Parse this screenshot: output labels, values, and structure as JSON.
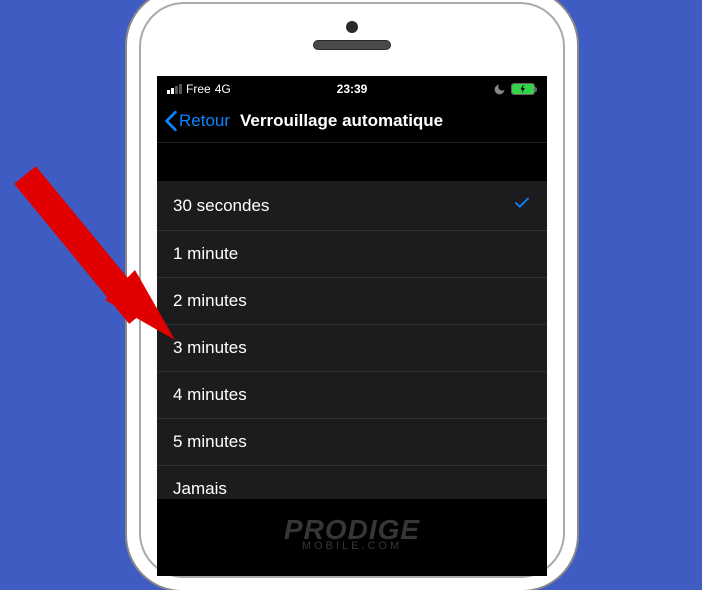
{
  "status": {
    "carrier": "Free",
    "network": "4G",
    "time": "23:39"
  },
  "nav": {
    "back_label": "Retour",
    "title": "Verrouillage automatique"
  },
  "options": [
    {
      "label": "30 secondes",
      "selected": true
    },
    {
      "label": "1 minute",
      "selected": false
    },
    {
      "label": "2 minutes",
      "selected": false
    },
    {
      "label": "3 minutes",
      "selected": false
    },
    {
      "label": "4 minutes",
      "selected": false
    },
    {
      "label": "5 minutes",
      "selected": false
    },
    {
      "label": "Jamais",
      "selected": false
    }
  ],
  "watermark": {
    "main": "PRODIGE",
    "sub": "MOBILE.COM"
  }
}
